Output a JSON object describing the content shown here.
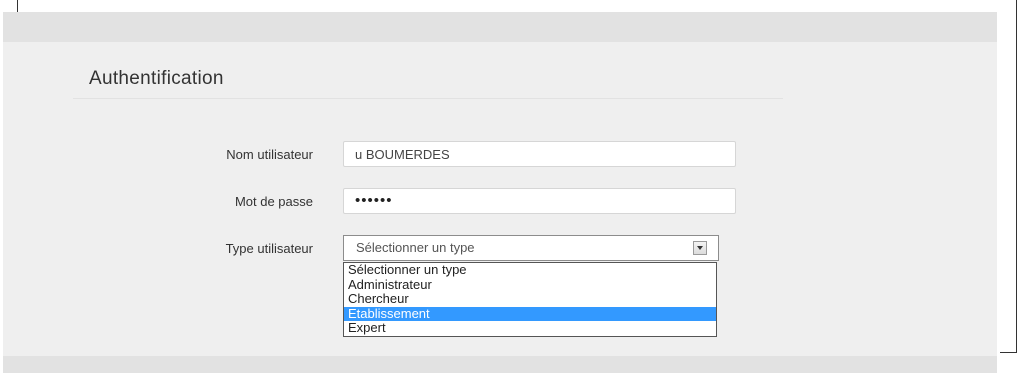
{
  "form": {
    "title": "Authentification",
    "username_label": "Nom utilisateur",
    "username_value": "u BOUMERDES",
    "password_label": "Mot de passe",
    "password_value": "••••••",
    "type_label": "Type utilisateur",
    "type_selected": "Sélectionner un type",
    "type_options": [
      "Sélectionner un type",
      "Administrateur",
      "Chercheur",
      "Etablissement",
      "Expert"
    ],
    "highlighted_option": "Etablissement"
  },
  "colors": {
    "panel_bg": "#efefef",
    "highlight": "#3399ff"
  },
  "icons": {
    "select_arrow": "chevron-down-icon"
  }
}
